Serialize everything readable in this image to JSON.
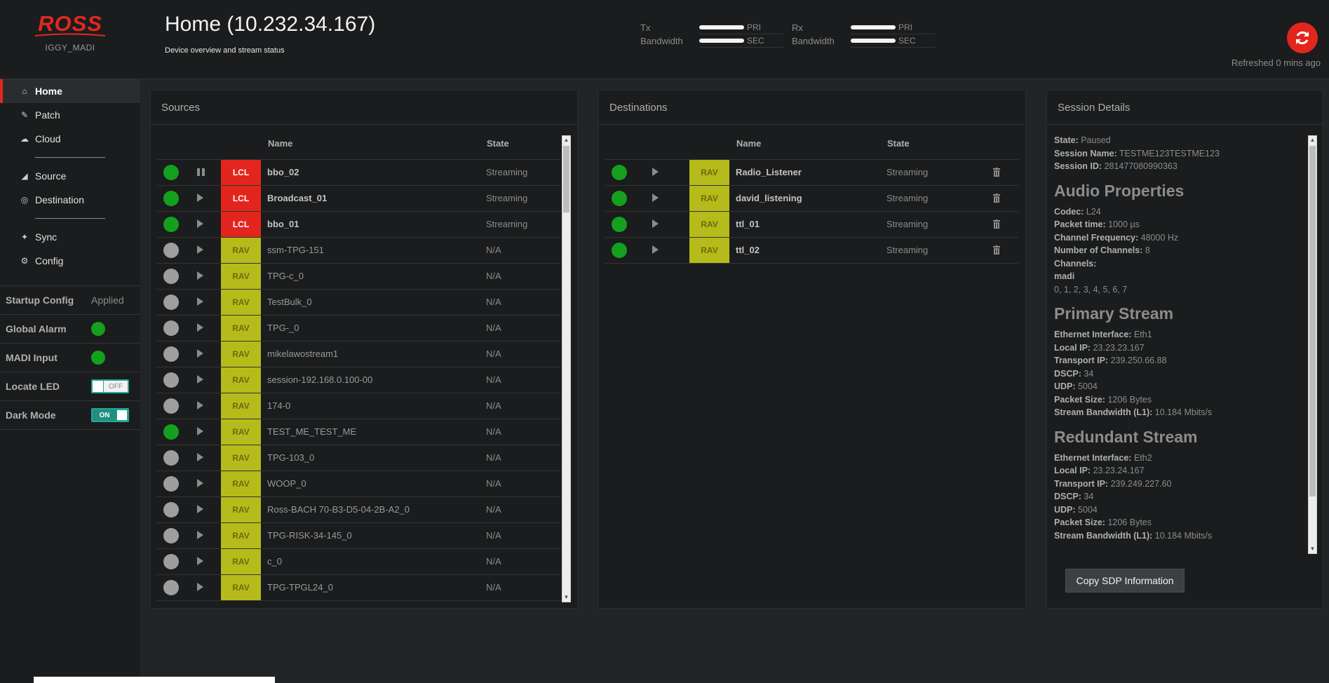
{
  "brand": {
    "logo_text": "ROSS",
    "device_name": "IGGY_MADI"
  },
  "header": {
    "title": "Home (10.232.34.167)",
    "subtitle": "Device overview and stream status",
    "tx": {
      "label_line1": "Tx",
      "label_line2": "Bandwidth",
      "pri": "PRI",
      "sec": "SEC"
    },
    "rx": {
      "label_line1": "Rx",
      "label_line2": "Bandwidth",
      "pri": "PRI",
      "sec": "SEC"
    },
    "refreshed": "Refreshed 0 mins ago",
    "accent_color": "#e3261d"
  },
  "nav": {
    "home": "Home",
    "patch": "Patch",
    "cloud": "Cloud",
    "source": "Source",
    "destination": "Destination",
    "sync": "Sync",
    "config": "Config"
  },
  "status_props": {
    "startup_config": {
      "label": "Startup Config",
      "value": "Applied"
    },
    "global_alarm": {
      "label": "Global Alarm",
      "status": "green"
    },
    "madi_input": {
      "label": "MADI Input",
      "status": "green"
    },
    "locate_led": {
      "label": "Locate LED",
      "toggle": "OFF"
    },
    "dark_mode": {
      "label": "Dark Mode",
      "toggle": "ON"
    }
  },
  "sources": {
    "title": "Sources",
    "col_name": "Name",
    "col_state": "State",
    "rows": [
      {
        "status": "green",
        "ctrl": "pause",
        "type": "LCL",
        "name": "bbo_02",
        "state": "Streaming",
        "bold": true
      },
      {
        "status": "green",
        "ctrl": "play",
        "type": "LCL",
        "name": "Broadcast_01",
        "state": "Streaming",
        "bold": true
      },
      {
        "status": "green",
        "ctrl": "play",
        "type": "LCL",
        "name": "bbo_01",
        "state": "Streaming",
        "bold": true
      },
      {
        "status": "grey",
        "ctrl": "play",
        "type": "RAV",
        "name": "ssm-TPG-151",
        "state": "N/A",
        "bold": false
      },
      {
        "status": "grey",
        "ctrl": "play",
        "type": "RAV",
        "name": "TPG-c_0",
        "state": "N/A",
        "bold": false
      },
      {
        "status": "grey",
        "ctrl": "play",
        "type": "RAV",
        "name": "TestBulk_0",
        "state": "N/A",
        "bold": false
      },
      {
        "status": "grey",
        "ctrl": "play",
        "type": "RAV",
        "name": "TPG-_0",
        "state": "N/A",
        "bold": false
      },
      {
        "status": "grey",
        "ctrl": "play",
        "type": "RAV",
        "name": "mikelawostream1",
        "state": "N/A",
        "bold": false
      },
      {
        "status": "grey",
        "ctrl": "play",
        "type": "RAV",
        "name": "session-192.168.0.100-00",
        "state": "N/A",
        "bold": false
      },
      {
        "status": "grey",
        "ctrl": "play",
        "type": "RAV",
        "name": "174-0",
        "state": "N/A",
        "bold": false
      },
      {
        "status": "green",
        "ctrl": "play",
        "type": "RAV",
        "name": "TEST_ME_TEST_ME",
        "state": "N/A",
        "bold": false
      },
      {
        "status": "grey",
        "ctrl": "play",
        "type": "RAV",
        "name": "TPG-103_0",
        "state": "N/A",
        "bold": false
      },
      {
        "status": "grey",
        "ctrl": "play",
        "type": "RAV",
        "name": "WOOP_0",
        "state": "N/A",
        "bold": false
      },
      {
        "status": "grey",
        "ctrl": "play",
        "type": "RAV",
        "name": "Ross-BACH 70-B3-D5-04-2B-A2_0",
        "state": "N/A",
        "bold": false
      },
      {
        "status": "grey",
        "ctrl": "play",
        "type": "RAV",
        "name": "TPG-RISK-34-145_0",
        "state": "N/A",
        "bold": false
      },
      {
        "status": "grey",
        "ctrl": "play",
        "type": "RAV",
        "name": "c_0",
        "state": "N/A",
        "bold": false
      },
      {
        "status": "grey",
        "ctrl": "play",
        "type": "RAV",
        "name": "TPG-TPGL24_0",
        "state": "N/A",
        "bold": false
      }
    ]
  },
  "destinations": {
    "title": "Destinations",
    "col_name": "Name",
    "col_state": "State",
    "rows": [
      {
        "status": "green",
        "type": "RAV",
        "name": "Radio_Listener",
        "state": "Streaming"
      },
      {
        "status": "green",
        "type": "RAV",
        "name": "david_listening",
        "state": "Streaming"
      },
      {
        "status": "green",
        "type": "RAV",
        "name": "ttl_01",
        "state": "Streaming"
      },
      {
        "status": "green",
        "type": "RAV",
        "name": "ttl_02",
        "state": "Streaming"
      }
    ]
  },
  "session": {
    "title": "Session Details",
    "state_label": "State:",
    "state": "Paused",
    "session_name_label": "Session Name:",
    "session_name": "TESTME123TESTME123",
    "session_id_label": "Session ID:",
    "session_id": "281477080990363",
    "audio_heading": "Audio Properties",
    "codec_label": "Codec:",
    "codec": "L24",
    "packet_time_label": "Packet time:",
    "packet_time": "1000 µs",
    "channel_freq_label": "Channel Frequency:",
    "channel_freq": "48000 Hz",
    "num_channels_label": "Number of Channels:",
    "num_channels": "8",
    "channels_label": "Channels:",
    "channels_group": "madi",
    "channels_list": "0, 1, 2, 3, 4, 5, 6, 7",
    "primary_heading": "Primary Stream",
    "primary": {
      "eth_label": "Ethernet Interface:",
      "eth": "Eth1",
      "local_ip_label": "Local IP:",
      "local_ip": "23.23.23.167",
      "transport_ip_label": "Transport IP:",
      "transport_ip": "239.250.66.88",
      "dscp_label": "DSCP:",
      "dscp": "34",
      "udp_label": "UDP:",
      "udp": "5004",
      "packet_size_label": "Packet Size:",
      "packet_size": "1206 Bytes",
      "bandwidth_label": "Stream Bandwidth (L1):",
      "bandwidth": "10.184 Mbits/s"
    },
    "redundant_heading": "Redundant Stream",
    "redundant": {
      "eth_label": "Ethernet Interface:",
      "eth": "Eth2",
      "local_ip_label": "Local IP:",
      "local_ip": "23.23.24.167",
      "transport_ip_label": "Transport IP:",
      "transport_ip": "239.249.227.60",
      "dscp_label": "DSCP:",
      "dscp": "34",
      "udp_label": "UDP:",
      "udp": "5004",
      "packet_size_label": "Packet Size:",
      "packet_size": "1206 Bytes",
      "bandwidth_label": "Stream Bandwidth (L1):",
      "bandwidth": "10.184 Mbits/s"
    },
    "copy_button": "Copy SDP Information"
  },
  "colors": {
    "green": "#14a01e",
    "grey": "#9e9e9e",
    "lcl": "#e3261d",
    "rav": "#b5bb1a",
    "toggle_teal": "#26a69a"
  }
}
